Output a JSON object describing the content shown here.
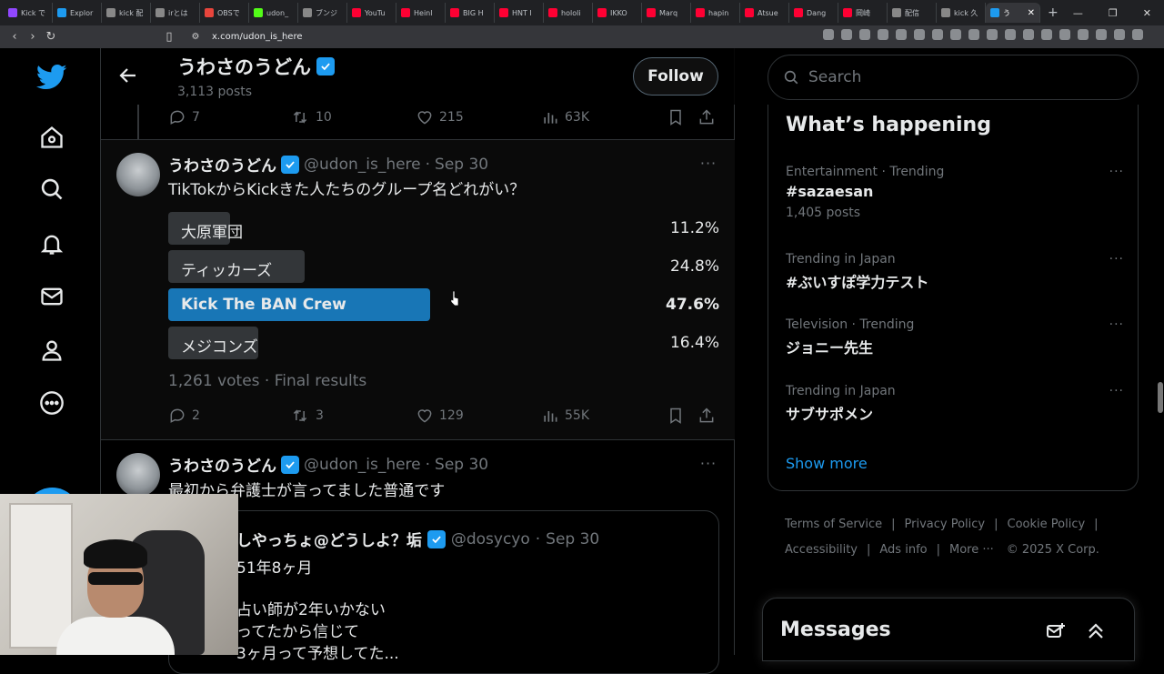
{
  "browser": {
    "tabs": [
      {
        "label": "Kick で",
        "color": "#9147ff"
      },
      {
        "label": "Explor",
        "color": "#1d9bf0"
      },
      {
        "label": "kick 配",
        "color": "#888888"
      },
      {
        "label": "irとは",
        "color": "#888888"
      },
      {
        "label": "OBSで",
        "color": "#e8453c"
      },
      {
        "label": "udon_",
        "color": "#53fc18"
      },
      {
        "label": "ブンジ",
        "color": "#888888"
      },
      {
        "label": "YouTu",
        "color": "#ff0033"
      },
      {
        "label": "Heinl",
        "color": "#ff0033"
      },
      {
        "label": "BIG H",
        "color": "#ff0033"
      },
      {
        "label": "HNT I",
        "color": "#ff0033"
      },
      {
        "label": "hololi",
        "color": "#ff0033"
      },
      {
        "label": "IKKO",
        "color": "#ff0033"
      },
      {
        "label": "Marq",
        "color": "#ff0033"
      },
      {
        "label": "hapin",
        "color": "#ff0033"
      },
      {
        "label": "Atsue",
        "color": "#ff0033"
      },
      {
        "label": "Dang",
        "color": "#ff0033"
      },
      {
        "label": "岡崎",
        "color": "#ff0033"
      },
      {
        "label": "配信",
        "color": "#888888"
      },
      {
        "label": "kick 久",
        "color": "#888888"
      }
    ],
    "active_tab": "う",
    "new_tab": "+",
    "url": "x.com/udon_is_here"
  },
  "header": {
    "name": "うわさのうどん",
    "posts": "3,113 posts",
    "follow_label": "Follow"
  },
  "prev_tweet_stats": {
    "replies": "7",
    "retweets": "10",
    "likes": "215",
    "views": "63K"
  },
  "poll_tweet": {
    "name": "うわさのうどん",
    "handle": "@udon_is_here",
    "date": "Sep 30",
    "sep": "·",
    "text": "TikTokからKickきた人たちのグループ名どれがい？",
    "options": [
      {
        "label": "大原軍団",
        "pct": "11.2%",
        "share": 0.112
      },
      {
        "label": "ティッカーズ",
        "pct": "24.8%",
        "share": 0.248
      },
      {
        "label": "Kick The BAN Crew",
        "pct": "47.6%",
        "share": 0.476
      },
      {
        "label": "メジコンズ",
        "pct": "16.4%",
        "share": 0.164
      }
    ],
    "votes": "1,261 votes · Final results",
    "stats": {
      "replies": "2",
      "retweets": "3",
      "likes": "129",
      "views": "55K"
    }
  },
  "second_tweet": {
    "name": "うわさのうどん",
    "handle": "@udon_is_here",
    "date": "Sep 30",
    "sep": "·",
    "text": "最初から弁護士が言ってました普通です"
  },
  "quote": {
    "name": "しやっちょ@どうしよ？垢",
    "handle": "@dosycyo",
    "date": "Sep 30",
    "sep": "·",
    "lines": [
      "51年8ヶ月",
      "占い師が2年いかない",
      "ってたから信じて",
      "3ヶ月って予想してた..."
    ]
  },
  "search": {
    "placeholder": "Search"
  },
  "trends": {
    "title": "What’s happening",
    "items": [
      {
        "context": "Entertainment · Trending",
        "name": "#sazaesan",
        "count": "1,405 posts"
      },
      {
        "context": "Trending in Japan",
        "name": "#ぶいすぽ学力テスト",
        "count": ""
      },
      {
        "context": "Television · Trending",
        "name": "ジョニー先生",
        "count": ""
      },
      {
        "context": "Trending in Japan",
        "name": "サブサポメン",
        "count": ""
      }
    ],
    "show_more": "Show more"
  },
  "footer": {
    "links": [
      "Terms of Service",
      "Privacy Policy",
      "Cookie Policy",
      "Accessibility",
      "Ads info",
      "More ···"
    ],
    "copyright": "© 2025 X Corp.",
    "sep": "|"
  },
  "messages": {
    "title": "Messages"
  },
  "colors": {
    "accent": "#1d9bf0",
    "bg": "#000000",
    "muted": "#71767b",
    "text": "#e7e9ea"
  }
}
